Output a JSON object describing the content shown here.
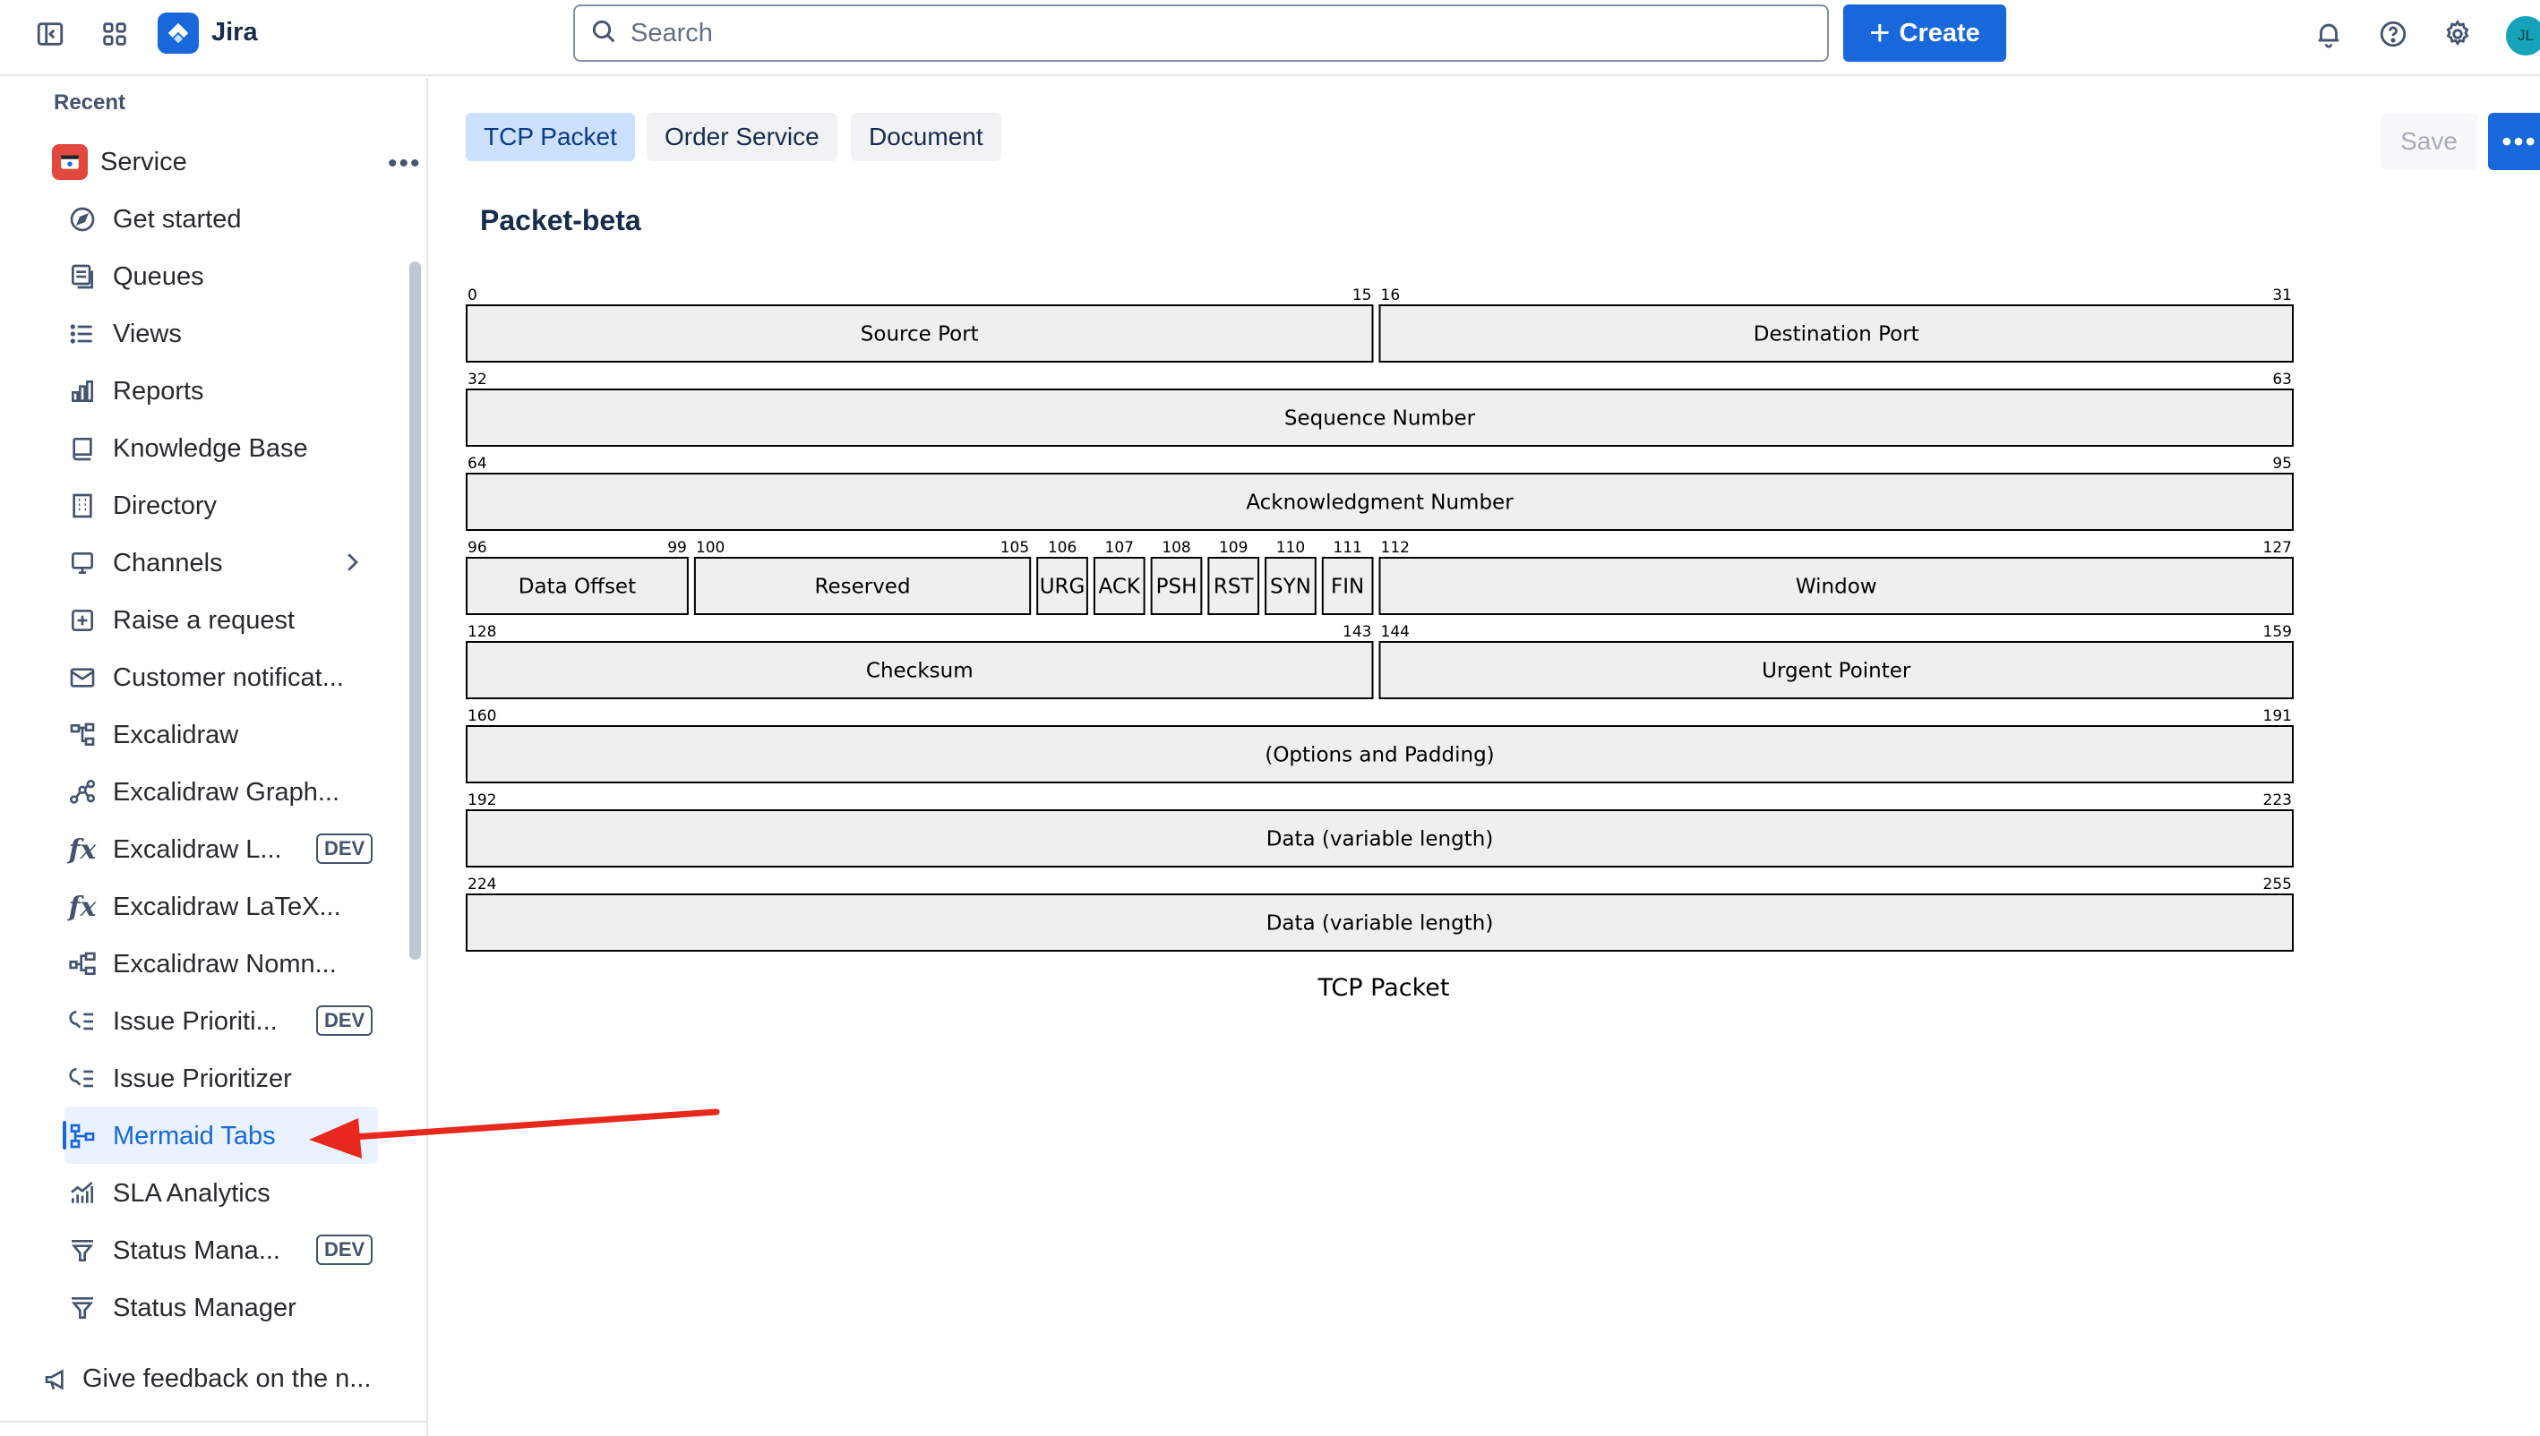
{
  "app": {
    "name": "Jira"
  },
  "topbar": {
    "search_placeholder": "Search",
    "create_label": "Create",
    "avatar_initials": "JL"
  },
  "sidebar": {
    "recent_label": "Recent",
    "service_label": "Service",
    "items": [
      {
        "label": "Get started",
        "icon": "compass-icon"
      },
      {
        "label": "Queues",
        "icon": "queues-icon"
      },
      {
        "label": "Views",
        "icon": "list-icon"
      },
      {
        "label": "Reports",
        "icon": "bar-chart-icon"
      },
      {
        "label": "Knowledge Base",
        "icon": "book-icon"
      },
      {
        "label": "Directory",
        "icon": "building-icon"
      },
      {
        "label": "Channels",
        "icon": "monitor-icon"
      },
      {
        "label": "Raise a request",
        "icon": "plus-square-icon"
      },
      {
        "label": "Customer notificat...",
        "icon": "envelope-icon"
      },
      {
        "label": "Excalidraw",
        "icon": "diagram-icon"
      },
      {
        "label": "Excalidraw Graph...",
        "icon": "graph-icon"
      },
      {
        "label": "Excalidraw L...",
        "icon": "function-icon",
        "badge": "DEV"
      },
      {
        "label": "Excalidraw LaTeX...",
        "icon": "function-icon"
      },
      {
        "label": "Excalidraw Nomn...",
        "icon": "diagram-icon"
      },
      {
        "label": "Issue Prioriti...",
        "icon": "prioritize-icon",
        "badge": "DEV"
      },
      {
        "label": "Issue Prioritizer",
        "icon": "prioritize-icon"
      },
      {
        "label": "Mermaid Tabs",
        "icon": "flow-icon",
        "selected": true
      },
      {
        "label": "SLA Analytics",
        "icon": "analytics-icon"
      },
      {
        "label": "Status Mana...",
        "icon": "filter-icon",
        "badge": "DEV"
      },
      {
        "label": "Status Manager",
        "icon": "filter-icon"
      }
    ],
    "feedback_label": "Give feedback on the n..."
  },
  "main": {
    "tabs": [
      {
        "label": "TCP Packet",
        "active": true
      },
      {
        "label": "Order Service",
        "active": false
      },
      {
        "label": "Document",
        "active": false
      }
    ],
    "save_label": "Save",
    "more_label": "•••",
    "page_title": "Packet-beta",
    "diagram_title": "TCP Packet"
  },
  "packet": {
    "bits_per_row": 32,
    "fields": [
      {
        "start": 0,
        "end": 15,
        "label": "Source Port"
      },
      {
        "start": 16,
        "end": 31,
        "label": "Destination Port"
      },
      {
        "start": 32,
        "end": 63,
        "label": "Sequence Number"
      },
      {
        "start": 64,
        "end": 95,
        "label": "Acknowledgment Number"
      },
      {
        "start": 96,
        "end": 99,
        "label": "Data Offset"
      },
      {
        "start": 100,
        "end": 105,
        "label": "Reserved"
      },
      {
        "start": 106,
        "end": 106,
        "label": "URG"
      },
      {
        "start": 107,
        "end": 107,
        "label": "ACK"
      },
      {
        "start": 108,
        "end": 108,
        "label": "PSH"
      },
      {
        "start": 109,
        "end": 109,
        "label": "RST"
      },
      {
        "start": 110,
        "end": 110,
        "label": "SYN"
      },
      {
        "start": 111,
        "end": 111,
        "label": "FIN"
      },
      {
        "start": 112,
        "end": 127,
        "label": "Window"
      },
      {
        "start": 128,
        "end": 143,
        "label": "Checksum"
      },
      {
        "start": 144,
        "end": 159,
        "label": "Urgent Pointer"
      },
      {
        "start": 160,
        "end": 191,
        "label": "(Options and Padding)"
      },
      {
        "start": 192,
        "end": 223,
        "label": "Data (variable length)"
      },
      {
        "start": 224,
        "end": 255,
        "label": "Data (variable length)"
      }
    ]
  },
  "colors": {
    "accent": "#1868db",
    "selected_bg": "#e9f2fe",
    "packet_fill": "#efefef",
    "annotation_arrow": "#e8281d"
  }
}
